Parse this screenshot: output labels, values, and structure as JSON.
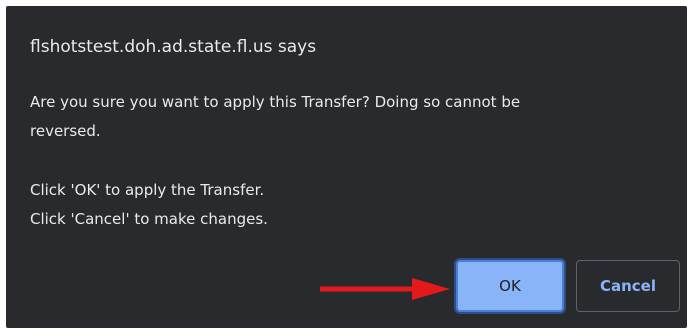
{
  "dialog": {
    "title": "flshotstest.doh.ad.state.fl.us says",
    "message": {
      "line1": "Are you sure you want to apply this Transfer?  Doing so cannot be",
      "line2": "reversed.",
      "line3": "Click 'OK' to apply the Transfer.",
      "line4": "Click 'Cancel' to make changes."
    },
    "buttons": {
      "ok_label": "OK",
      "cancel_label": "Cancel"
    }
  },
  "annotation": {
    "arrow_icon": "red-arrow-right-icon",
    "arrow_color": "#e3191b"
  },
  "colors": {
    "dialog_background": "#292a2d",
    "text": "#e8eaed",
    "accent": "#8ab4f8"
  }
}
